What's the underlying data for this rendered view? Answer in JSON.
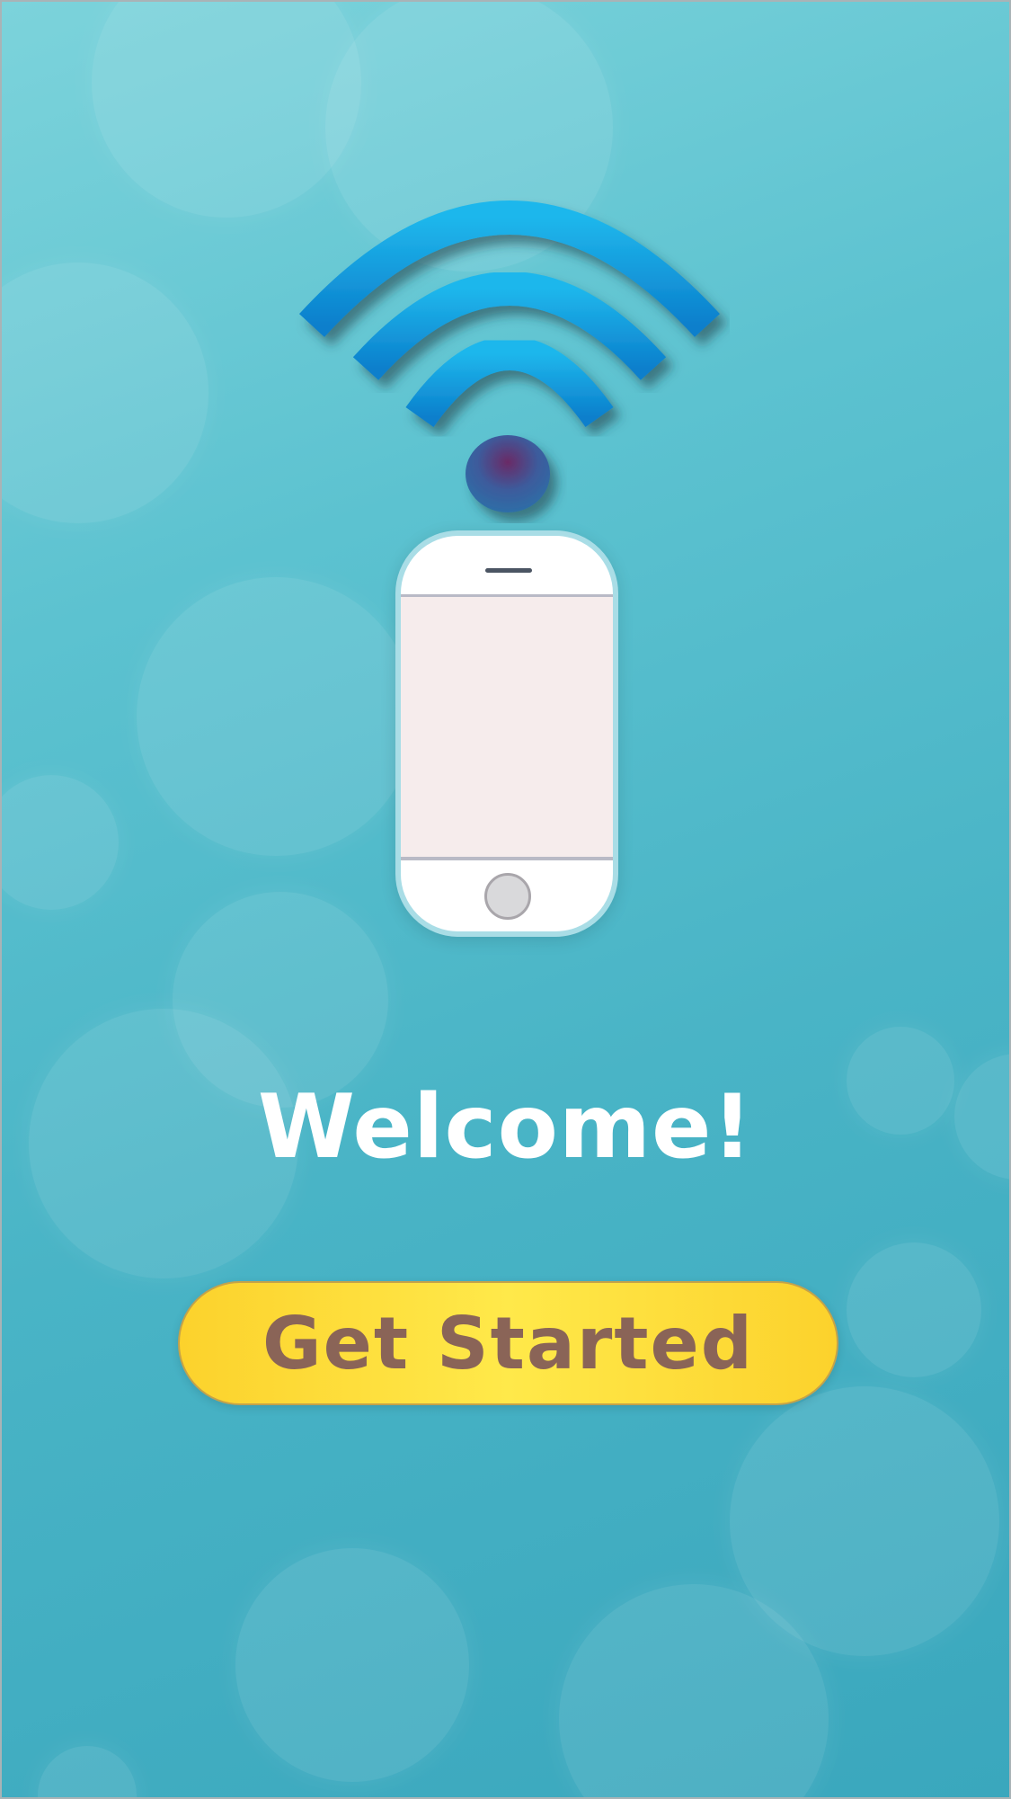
{
  "welcome": {
    "title": "Welcome!",
    "cta_label": "Get Started"
  },
  "icons": {
    "hero": "wifi-icon",
    "device": "smartphone-icon"
  },
  "colors": {
    "background": "#5cc2d0",
    "wifi_blue": "#19a8e3",
    "button_yellow": "#fdd835",
    "button_text": "#8a6457",
    "title_text": "#ffffff"
  }
}
